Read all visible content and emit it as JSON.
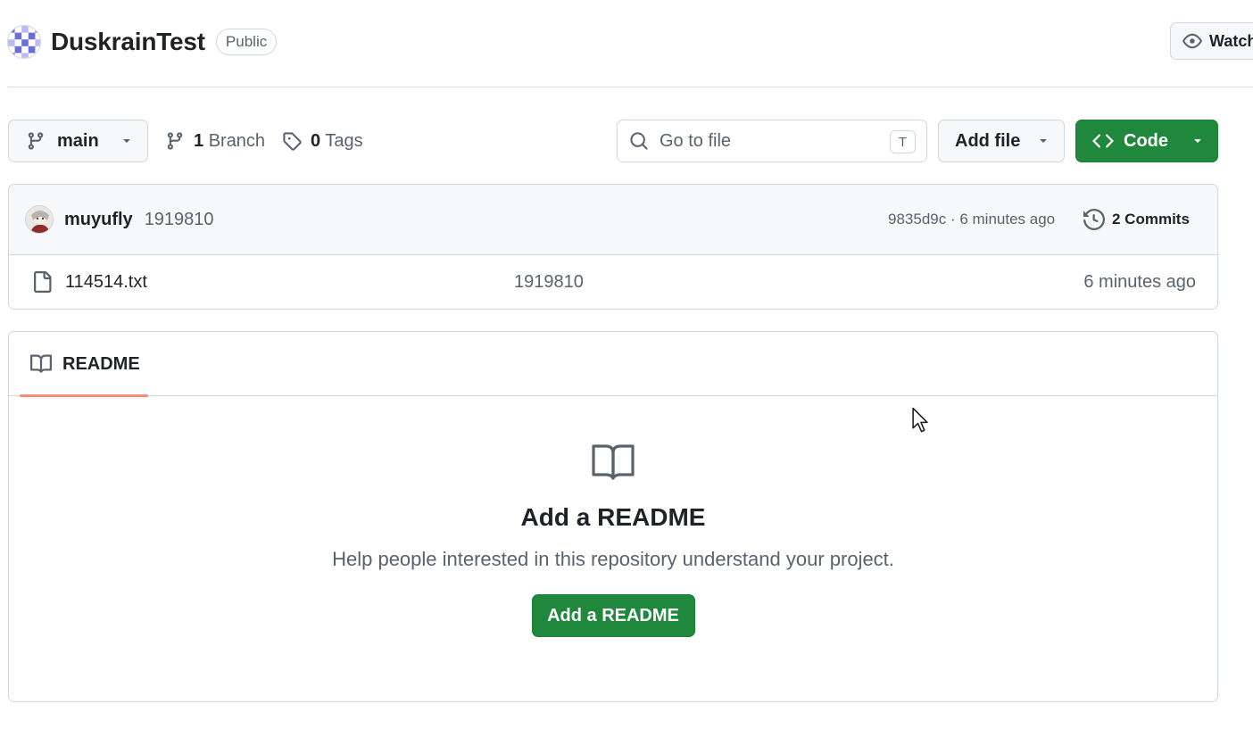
{
  "repo": {
    "name": "DuskrainTest",
    "visibility": "Public",
    "watch_label": "Watch"
  },
  "toolbar": {
    "branch": "main",
    "branch_count": "1",
    "branch_label": "Branch",
    "tag_count": "0",
    "tag_label": "Tags",
    "search_placeholder": "Go to file",
    "search_shortcut": "T",
    "add_file_label": "Add file",
    "code_label": "Code"
  },
  "latest_commit": {
    "author": "muyufly",
    "message": "1919810",
    "meta": "9835d9c · 6 minutes ago",
    "commits_label": "2 Commits"
  },
  "files": [
    {
      "name": "114514.txt",
      "commit_message": "1919810",
      "age": "6 minutes ago",
      "icon": "file-icon"
    }
  ],
  "readme": {
    "tab_label": "README",
    "empty_title": "Add a README",
    "empty_description": "Help people interested in this repository understand your project.",
    "add_button_label": "Add a README"
  },
  "colors": {
    "primary_green": "#1f883d",
    "tab_underline": "#fd8c73",
    "border": "#d0d7de",
    "muted_text": "#59636e"
  }
}
